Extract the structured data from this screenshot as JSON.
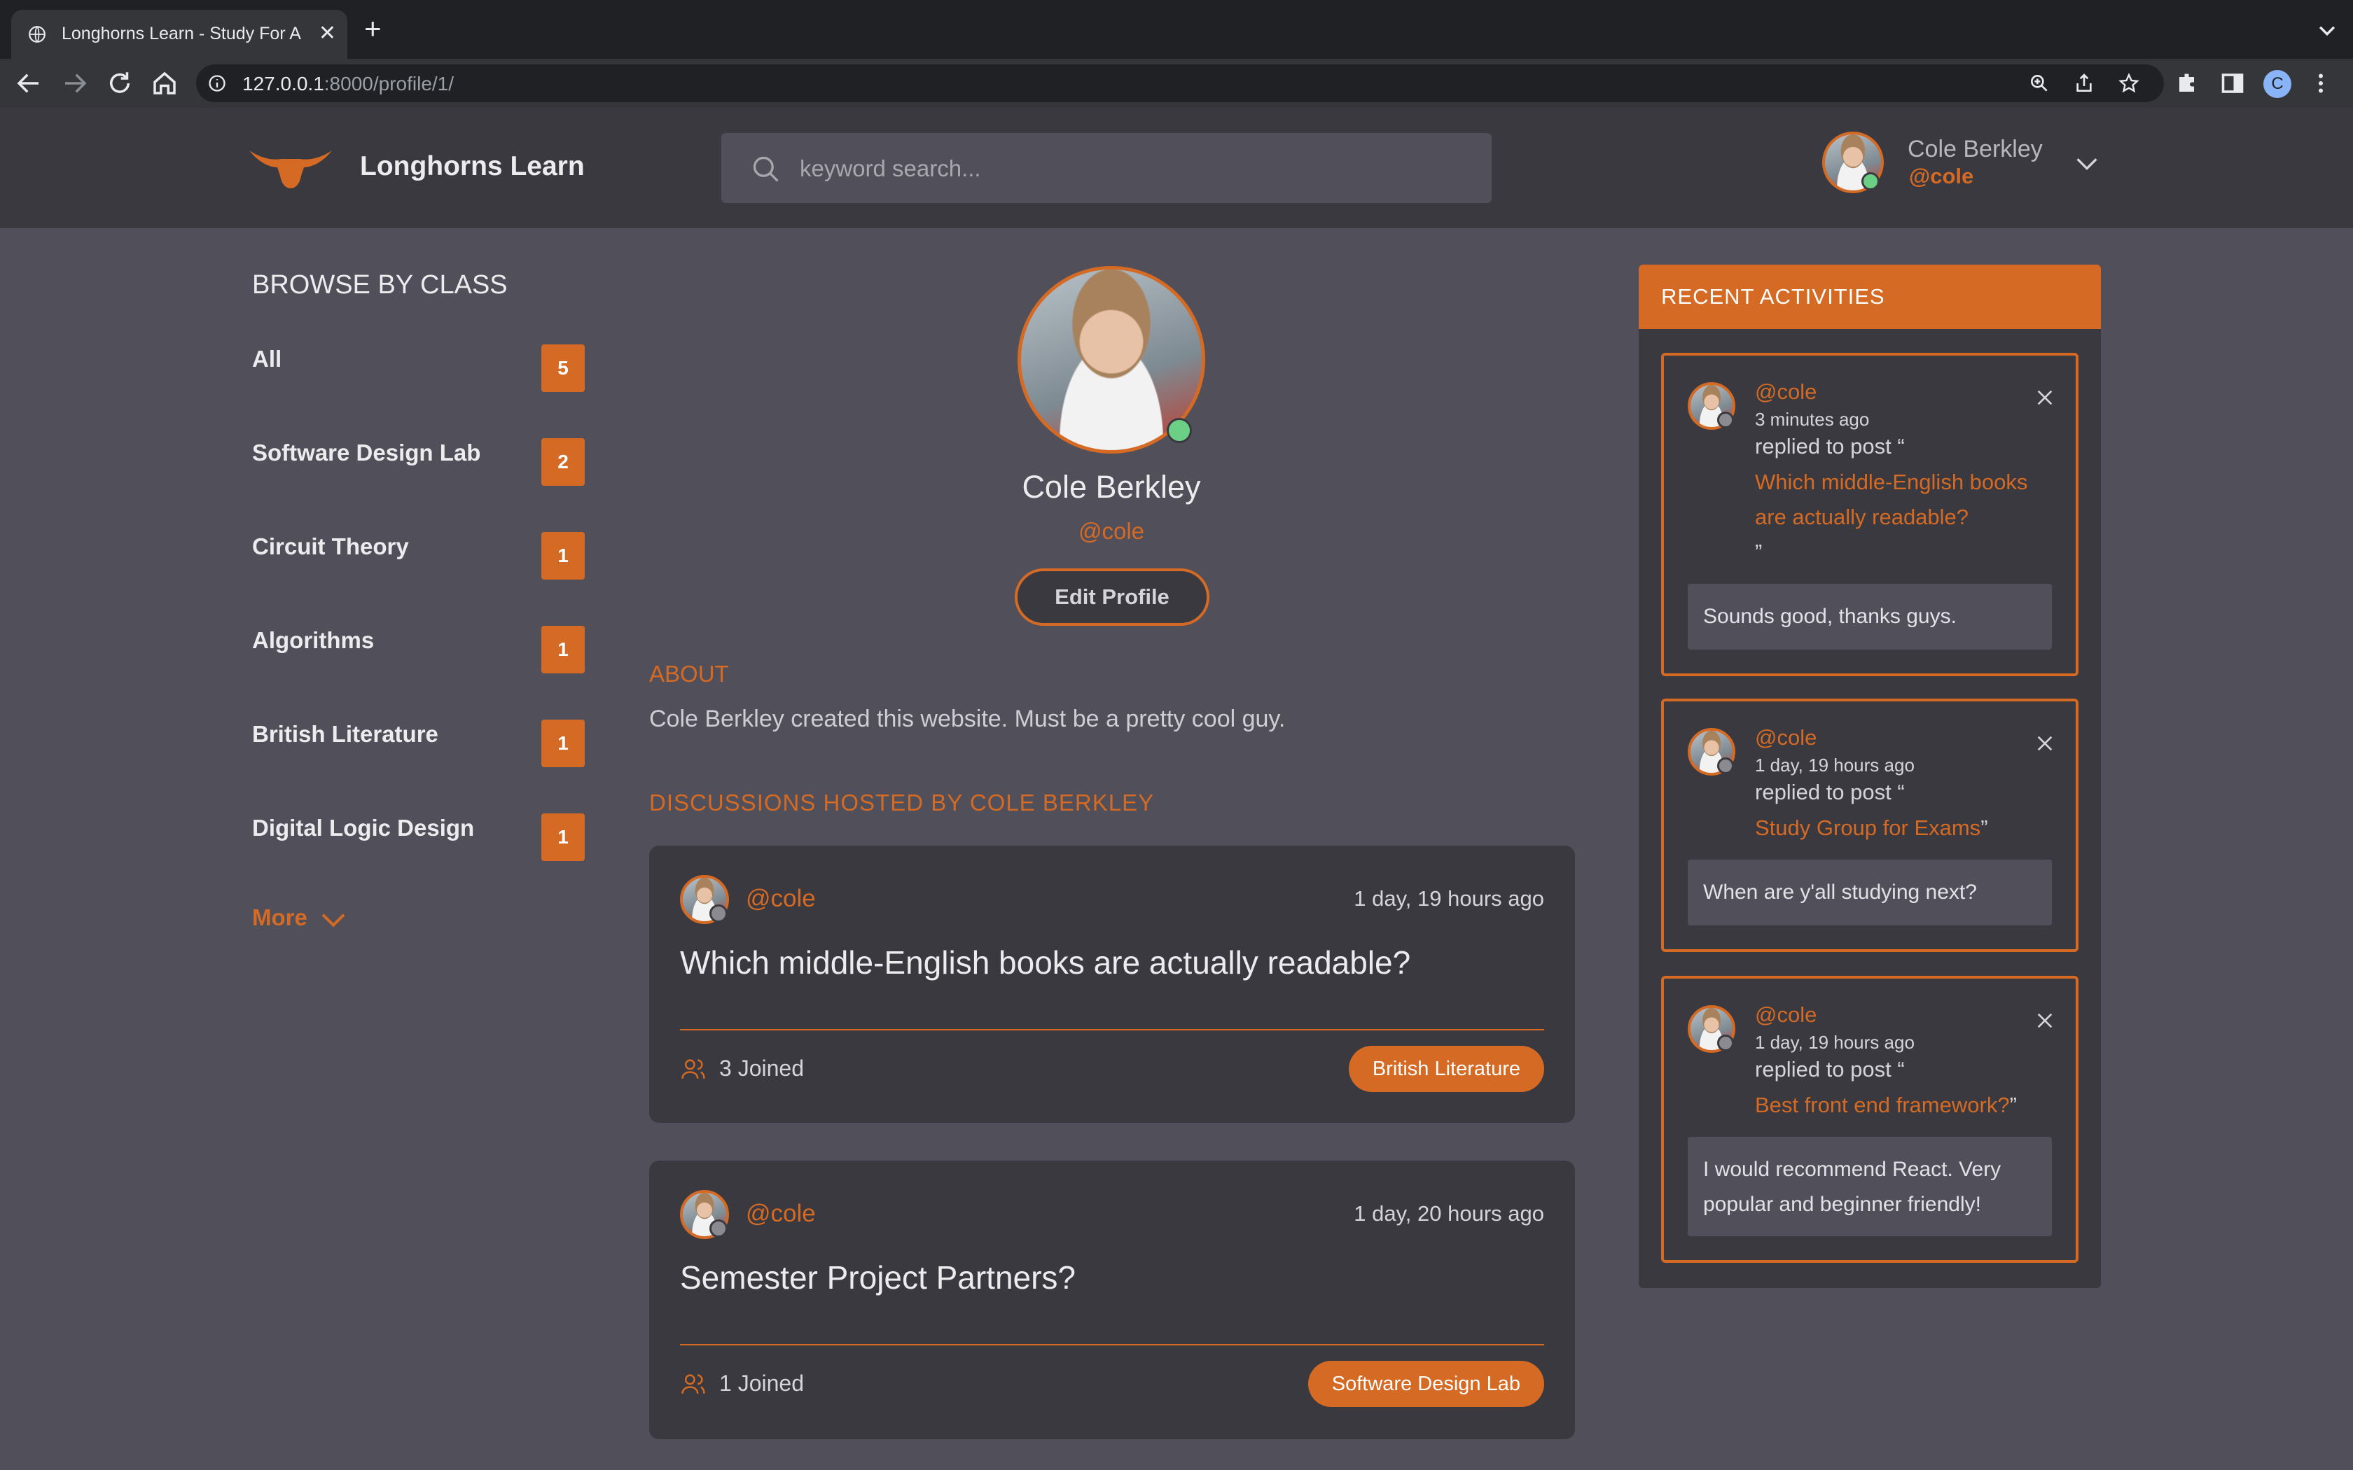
{
  "browser": {
    "tab_title": "Longhorns Learn - Study For A",
    "url_host": "127.0.0.1",
    "url_rest": ":8000/profile/1/",
    "profile_initial": "C"
  },
  "header": {
    "brand": "Longhorns Learn",
    "search_placeholder": "keyword search...",
    "user_name": "Cole Berkley",
    "user_handle": "@cole"
  },
  "sidebar": {
    "title": "BROWSE BY CLASS",
    "topics": [
      {
        "name": "All",
        "count": "5"
      },
      {
        "name": "Software Design Lab",
        "count": "2"
      },
      {
        "name": "Circuit Theory",
        "count": "1"
      },
      {
        "name": "Algorithms",
        "count": "1"
      },
      {
        "name": "British Literature",
        "count": "1"
      },
      {
        "name": "Digital Logic Design",
        "count": "1"
      }
    ],
    "more": "More"
  },
  "profile": {
    "name": "Cole Berkley",
    "handle": "@cole",
    "edit_label": "Edit Profile",
    "about_heading": "ABOUT",
    "about_text": "Cole Berkley created this website. Must be a pretty cool guy.",
    "discussions_heading": "DISCUSSIONS HOSTED BY COLE BERKLEY"
  },
  "rooms": [
    {
      "handle": "@cole",
      "time": "1 day, 19 hours ago",
      "title": "Which middle-English books are actually readable?",
      "joined": "3 Joined",
      "topic": "British Literature"
    },
    {
      "handle": "@cole",
      "time": "1 day, 20 hours ago",
      "title": "Semester Project Partners?",
      "joined": "1 Joined",
      "topic": "Software Design Lab"
    }
  ],
  "activities": {
    "heading": "RECENT ACTIVITIES",
    "items": [
      {
        "handle": "@cole",
        "time": "3 minutes ago",
        "replied": "replied to post “",
        "post": "Which middle-English books are actually readable?",
        "close_quote": "”",
        "message": "Sounds good, thanks guys."
      },
      {
        "handle": "@cole",
        "time": "1 day, 19 hours ago",
        "replied": "replied to post “",
        "post": "Study Group for Exams",
        "close_quote": "”",
        "message": "When are y'all studying next?"
      },
      {
        "handle": "@cole",
        "time": "1 day, 19 hours ago",
        "replied": "replied to post “",
        "post": "Best front end framework?",
        "close_quote": "”",
        "message": "I would recommend React. Very popular and beginner friendly!"
      }
    ]
  },
  "colors": {
    "accent": "#d46a24",
    "page_bg": "#51505a",
    "panel_bg": "#3a393f",
    "online": "#6ccf86"
  }
}
